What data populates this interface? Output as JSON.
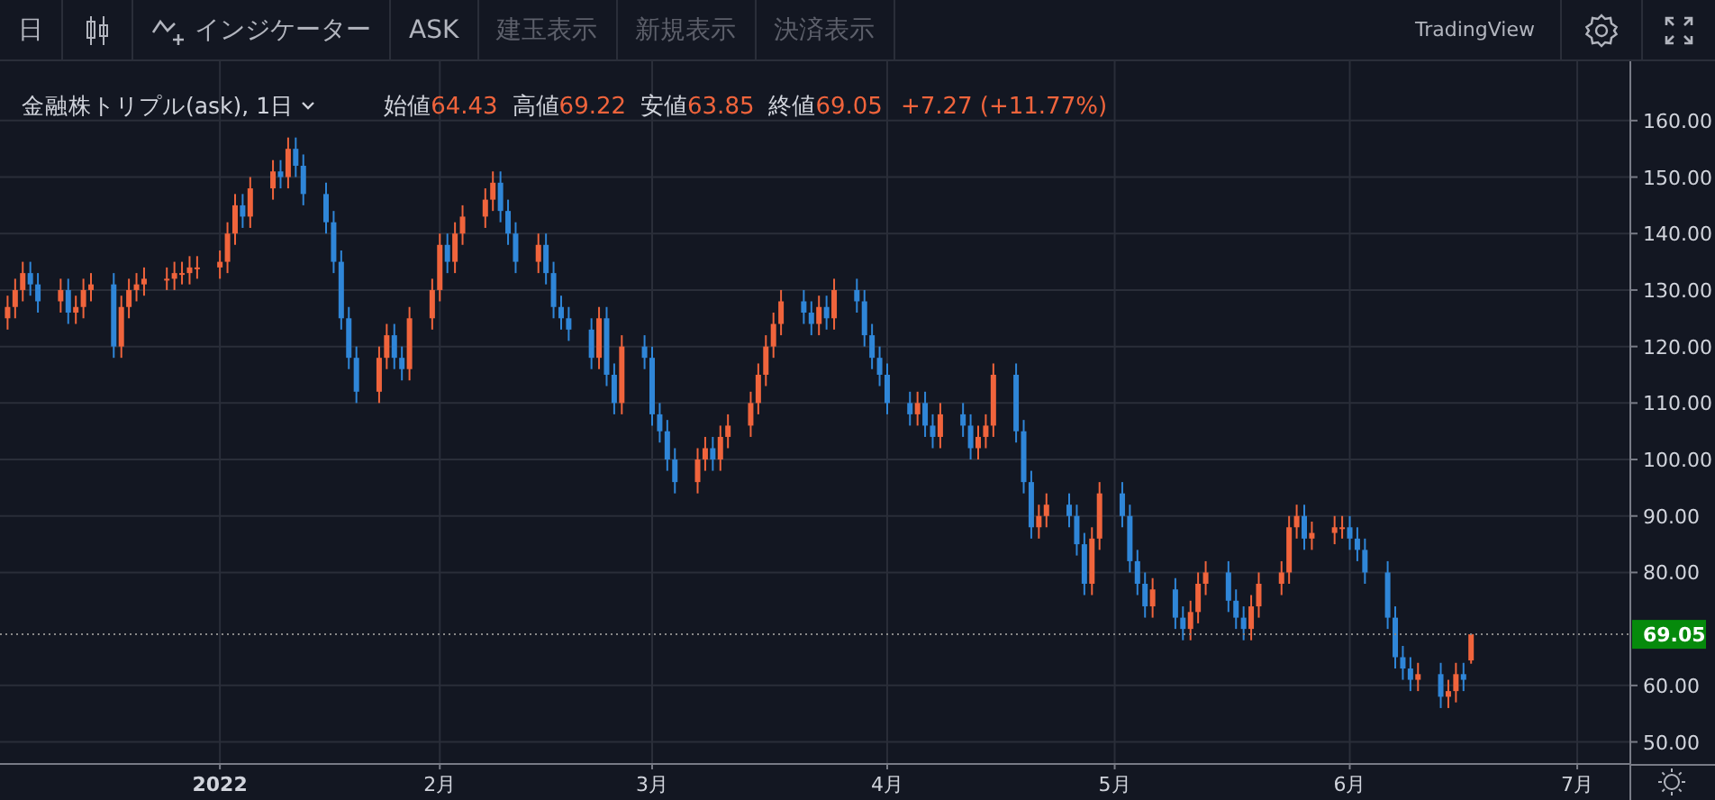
{
  "toolbar": {
    "items": [
      {
        "kind": "text",
        "label": "日",
        "disabled": false
      },
      {
        "kind": "candles",
        "disabled": false
      },
      {
        "kind": "indicator",
        "label": "インジケーター",
        "disabled": false
      },
      {
        "kind": "text",
        "label": "ASK",
        "disabled": false
      },
      {
        "kind": "text",
        "label": "建玉表示",
        "disabled": true
      },
      {
        "kind": "text",
        "label": "新規表示",
        "disabled": true
      },
      {
        "kind": "text",
        "label": "決済表示",
        "disabled": true
      }
    ],
    "brand": "TradingView"
  },
  "legend": {
    "symbol": "金融株トリプル(ask), 1日",
    "fields": [
      {
        "label": "始値",
        "value": "64.43"
      },
      {
        "label": "高値",
        "value": "69.22"
      },
      {
        "label": "安値",
        "value": "63.85"
      },
      {
        "label": "終値",
        "value": "69.05"
      }
    ],
    "change": "+7.27 (+11.77%)"
  },
  "chart": {
    "chart_data": {
      "type": "candlestick",
      "grid": true,
      "ref_lines": [
        {
          "axis": "y",
          "value": 69.05,
          "label": "69.05"
        }
      ],
      "xlim": [
        "2021-12-05",
        "2022-07-08"
      ],
      "ylim": [
        46.1,
        170.5
      ],
      "xticks": [
        {
          "value": "2022-01-03",
          "label": "2022"
        },
        {
          "value": "2022-02-01",
          "label": "2月"
        },
        {
          "value": "2022-03-01",
          "label": "3月"
        },
        {
          "value": "2022-04-01",
          "label": "4月"
        },
        {
          "value": "2022-05-01",
          "label": "5月"
        },
        {
          "value": "2022-06-01",
          "label": "6月"
        },
        {
          "value": "2022-07-01",
          "label": "7月"
        }
      ],
      "yticks": [
        {
          "value": 50,
          "label": "50.00"
        },
        {
          "value": 60,
          "label": "60.00"
        },
        {
          "value": 80,
          "label": "80.00"
        },
        {
          "value": 90,
          "label": "90.00"
        },
        {
          "value": 100,
          "label": "100.00"
        },
        {
          "value": 110,
          "label": "110.00"
        },
        {
          "value": 120,
          "label": "120.00"
        },
        {
          "value": 130,
          "label": "130.00"
        },
        {
          "value": 140,
          "label": "140.00"
        },
        {
          "value": 150,
          "label": "150.00"
        },
        {
          "value": 160,
          "label": "160.00"
        }
      ],
      "x": [
        "2021-12-06",
        "2021-12-07",
        "2021-12-08",
        "2021-12-09",
        "2021-12-10",
        "2021-12-13",
        "2021-12-14",
        "2021-12-15",
        "2021-12-16",
        "2021-12-17",
        "2021-12-20",
        "2021-12-21",
        "2021-12-22",
        "2021-12-23",
        "2021-12-24",
        "2021-12-27",
        "2021-12-28",
        "2021-12-29",
        "2021-12-30",
        "2021-12-31",
        "2022-01-03",
        "2022-01-04",
        "2022-01-05",
        "2022-01-06",
        "2022-01-07",
        "2022-01-10",
        "2022-01-11",
        "2022-01-12",
        "2022-01-13",
        "2022-01-14",
        "2022-01-17",
        "2022-01-18",
        "2022-01-19",
        "2022-01-20",
        "2022-01-21",
        "2022-01-24",
        "2022-01-25",
        "2022-01-26",
        "2022-01-27",
        "2022-01-28",
        "2022-01-31",
        "2022-02-01",
        "2022-02-02",
        "2022-02-03",
        "2022-02-04",
        "2022-02-07",
        "2022-02-08",
        "2022-02-09",
        "2022-02-10",
        "2022-02-11",
        "2022-02-14",
        "2022-02-15",
        "2022-02-16",
        "2022-02-17",
        "2022-02-18",
        "2022-02-21",
        "2022-02-22",
        "2022-02-23",
        "2022-02-24",
        "2022-02-25",
        "2022-02-28",
        "2022-03-01",
        "2022-03-02",
        "2022-03-03",
        "2022-03-04",
        "2022-03-07",
        "2022-03-08",
        "2022-03-09",
        "2022-03-10",
        "2022-03-11",
        "2022-03-14",
        "2022-03-15",
        "2022-03-16",
        "2022-03-17",
        "2022-03-18",
        "2022-03-21",
        "2022-03-22",
        "2022-03-23",
        "2022-03-24",
        "2022-03-25",
        "2022-03-28",
        "2022-03-29",
        "2022-03-30",
        "2022-03-31",
        "2022-04-01",
        "2022-04-04",
        "2022-04-05",
        "2022-04-06",
        "2022-04-07",
        "2022-04-08",
        "2022-04-11",
        "2022-04-12",
        "2022-04-13",
        "2022-04-14",
        "2022-04-15",
        "2022-04-18",
        "2022-04-19",
        "2022-04-20",
        "2022-04-21",
        "2022-04-22",
        "2022-04-25",
        "2022-04-26",
        "2022-04-27",
        "2022-04-28",
        "2022-04-29",
        "2022-05-02",
        "2022-05-03",
        "2022-05-04",
        "2022-05-05",
        "2022-05-06",
        "2022-05-09",
        "2022-05-10",
        "2022-05-11",
        "2022-05-12",
        "2022-05-13",
        "2022-05-16",
        "2022-05-17",
        "2022-05-18",
        "2022-05-19",
        "2022-05-20",
        "2022-05-23",
        "2022-05-24",
        "2022-05-25",
        "2022-05-26",
        "2022-05-27",
        "2022-05-30",
        "2022-05-31",
        "2022-06-01",
        "2022-06-02",
        "2022-06-03",
        "2022-06-06",
        "2022-06-07",
        "2022-06-08",
        "2022-06-09",
        "2022-06-10",
        "2022-06-13",
        "2022-06-14",
        "2022-06-15",
        "2022-06-16",
        "2022-06-17"
      ],
      "ohlc": [
        [
          125,
          129,
          123,
          127
        ],
        [
          127,
          132,
          125,
          130
        ],
        [
          130,
          135,
          128,
          133
        ],
        [
          133,
          135,
          129,
          131
        ],
        [
          131,
          133,
          126,
          128
        ],
        [
          128,
          132,
          126,
          130
        ],
        [
          130,
          132,
          124,
          126
        ],
        [
          126,
          129,
          124,
          127
        ],
        [
          127,
          132,
          125,
          130
        ],
        [
          130,
          133,
          128,
          131
        ],
        [
          131,
          133,
          118,
          120
        ],
        [
          120,
          129,
          118,
          127
        ],
        [
          127,
          132,
          125,
          130
        ],
        [
          130,
          133,
          128,
          131
        ],
        [
          131,
          134,
          129,
          132
        ],
        [
          132,
          134,
          130,
          132
        ],
        [
          132,
          135,
          130,
          133
        ],
        [
          133,
          135,
          131,
          133
        ],
        [
          133,
          136,
          131,
          134
        ],
        [
          134,
          136,
          132,
          134
        ],
        [
          134,
          137,
          132,
          135
        ],
        [
          135,
          142,
          133,
          140
        ],
        [
          140,
          147,
          138,
          145
        ],
        [
          145,
          147,
          141,
          143
        ],
        [
          143,
          150,
          141,
          148
        ],
        [
          148,
          153,
          146,
          151
        ],
        [
          151,
          153,
          148,
          150
        ],
        [
          150,
          157,
          148,
          155
        ],
        [
          155,
          157,
          150,
          152
        ],
        [
          152,
          154,
          145,
          147
        ],
        [
          147,
          149,
          140,
          142
        ],
        [
          142,
          144,
          133,
          135
        ],
        [
          135,
          137,
          123,
          125
        ],
        [
          125,
          127,
          116,
          118
        ],
        [
          118,
          120,
          110,
          112
        ],
        [
          112,
          120,
          110,
          118
        ],
        [
          118,
          124,
          116,
          122
        ],
        [
          122,
          124,
          116,
          118
        ],
        [
          118,
          120,
          114,
          116
        ],
        [
          116,
          127,
          114,
          125
        ],
        [
          125,
          132,
          123,
          130
        ],
        [
          130,
          140,
          128,
          138
        ],
        [
          138,
          140,
          133,
          135
        ],
        [
          135,
          142,
          133,
          140
        ],
        [
          140,
          145,
          138,
          143
        ],
        [
          143,
          148,
          141,
          146
        ],
        [
          146,
          151,
          144,
          149
        ],
        [
          149,
          151,
          142,
          144
        ],
        [
          144,
          146,
          138,
          140
        ],
        [
          140,
          142,
          133,
          135
        ],
        [
          135,
          140,
          133,
          138
        ],
        [
          138,
          140,
          131,
          133
        ],
        [
          133,
          135,
          125,
          127
        ],
        [
          127,
          129,
          123,
          125
        ],
        [
          125,
          127,
          121,
          123
        ],
        [
          123,
          125,
          116,
          118
        ],
        [
          118,
          127,
          116,
          125
        ],
        [
          125,
          127,
          113,
          115
        ],
        [
          115,
          117,
          108,
          110
        ],
        [
          110,
          122,
          108,
          120
        ],
        [
          120,
          122,
          116,
          118
        ],
        [
          118,
          120,
          106,
          108
        ],
        [
          108,
          110,
          103,
          105
        ],
        [
          105,
          107,
          98,
          100
        ],
        [
          100,
          102,
          94,
          96
        ],
        [
          96,
          102,
          94,
          100
        ],
        [
          100,
          104,
          98,
          102
        ],
        [
          102,
          104,
          98,
          100
        ],
        [
          100,
          106,
          98,
          104
        ],
        [
          104,
          108,
          102,
          106
        ],
        [
          106,
          112,
          104,
          110
        ],
        [
          110,
          117,
          108,
          115
        ],
        [
          115,
          122,
          113,
          120
        ],
        [
          120,
          126,
          118,
          124
        ],
        [
          124,
          130,
          122,
          128
        ],
        [
          128,
          130,
          124,
          126
        ],
        [
          126,
          128,
          122,
          124
        ],
        [
          124,
          129,
          122,
          127
        ],
        [
          127,
          129,
          123,
          125
        ],
        [
          125,
          132,
          123,
          130
        ],
        [
          130,
          132,
          126,
          128
        ],
        [
          128,
          130,
          120,
          122
        ],
        [
          122,
          124,
          116,
          118
        ],
        [
          118,
          120,
          113,
          115
        ],
        [
          115,
          117,
          108,
          110
        ],
        [
          110,
          112,
          106,
          108
        ],
        [
          108,
          112,
          106,
          110
        ],
        [
          110,
          112,
          104,
          106
        ],
        [
          106,
          108,
          102,
          104
        ],
        [
          104,
          110,
          102,
          108
        ],
        [
          108,
          110,
          104,
          106
        ],
        [
          106,
          108,
          100,
          102
        ],
        [
          102,
          106,
          100,
          104
        ],
        [
          104,
          108,
          102,
          106
        ],
        [
          106,
          117,
          104,
          115
        ],
        [
          115,
          117,
          103,
          105
        ],
        [
          105,
          107,
          94,
          96
        ],
        [
          96,
          98,
          86,
          88
        ],
        [
          88,
          92,
          86,
          90
        ],
        [
          90,
          94,
          88,
          92
        ],
        [
          92,
          94,
          88,
          90
        ],
        [
          90,
          92,
          83,
          85
        ],
        [
          85,
          87,
          76,
          78
        ],
        [
          78,
          88,
          76,
          86
        ],
        [
          86,
          96,
          84,
          94
        ],
        [
          94,
          96,
          88,
          90
        ],
        [
          90,
          92,
          80,
          82
        ],
        [
          82,
          84,
          76,
          78
        ],
        [
          78,
          80,
          72,
          74
        ],
        [
          74,
          79,
          72,
          77
        ],
        [
          77,
          79,
          70,
          72
        ],
        [
          72,
          74,
          68,
          70
        ],
        [
          70,
          75,
          68,
          73
        ],
        [
          73,
          80,
          71,
          78
        ],
        [
          78,
          82,
          76,
          80
        ],
        [
          80,
          82,
          73,
          75
        ],
        [
          75,
          77,
          70,
          72
        ],
        [
          72,
          74,
          68,
          70
        ],
        [
          70,
          76,
          68,
          74
        ],
        [
          74,
          80,
          72,
          78
        ],
        [
          78,
          82,
          76,
          80
        ],
        [
          80,
          90,
          78,
          88
        ],
        [
          88,
          92,
          86,
          90
        ],
        [
          90,
          92,
          84,
          86
        ],
        [
          86,
          89,
          84,
          87
        ],
        [
          87,
          90,
          85,
          88
        ],
        [
          88,
          90,
          86,
          88
        ],
        [
          88,
          90,
          84,
          86
        ],
        [
          86,
          88,
          82,
          84
        ],
        [
          84,
          86,
          78,
          80
        ],
        [
          80,
          82,
          70,
          72
        ],
        [
          72,
          74,
          63,
          65
        ],
        [
          65,
          67,
          61,
          63
        ],
        [
          63,
          65,
          59,
          61
        ],
        [
          61,
          64,
          59,
          62
        ],
        [
          62,
          64,
          56,
          58
        ],
        [
          58,
          61,
          56,
          59
        ],
        [
          59,
          64,
          57,
          62
        ],
        [
          62,
          64,
          59,
          61
        ],
        [
          64.43,
          69.22,
          63.85,
          69.05
        ]
      ]
    }
  }
}
